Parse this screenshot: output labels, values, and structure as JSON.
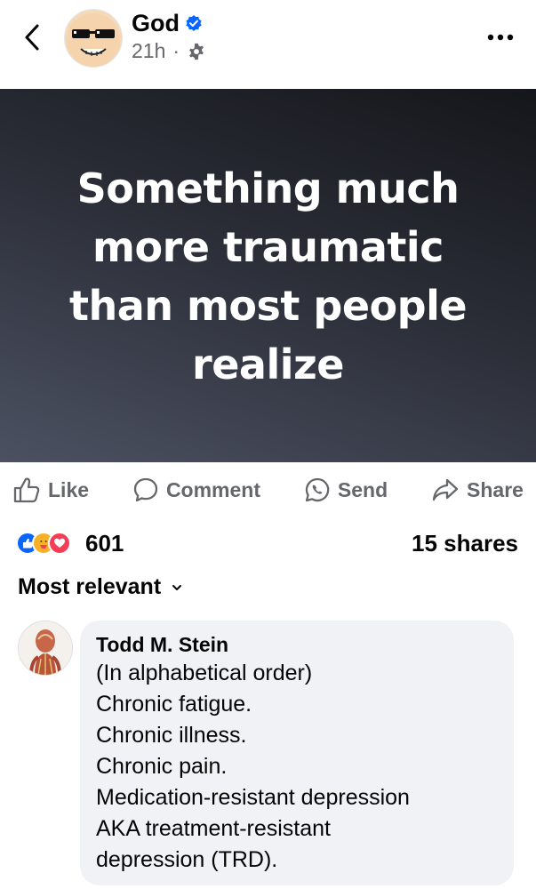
{
  "header": {
    "author_name": "God",
    "timestamp": "21h",
    "separator": "·",
    "icons": {
      "back": "chevron-left-icon",
      "verified": "verified-badge-icon",
      "privacy": "gear-icon",
      "more": "more-dots-icon"
    }
  },
  "post": {
    "text": "Something much more traumatic than most people realize",
    "background_colors": [
      "#15161b",
      "#4c5162"
    ]
  },
  "actions": {
    "like": "Like",
    "comment": "Comment",
    "send": "Send",
    "share": "Share"
  },
  "reactions": {
    "types": [
      "like",
      "care",
      "love"
    ],
    "count": "601",
    "shares": "15 shares"
  },
  "comments": {
    "sort_label": "Most relevant",
    "items": [
      {
        "author": "Todd M. Stein",
        "lines": [
          "(In alphabetical order)",
          "Chronic fatigue.",
          "Chronic illness.",
          "Chronic pain.",
          "Medication-resistant depression",
          "AKA treatment-resistant",
          "depression (TRD)."
        ]
      }
    ]
  },
  "colors": {
    "accent": "#0866ff",
    "secondary_text": "#65676b",
    "love": "#f33e58",
    "care": "#f7b125",
    "bubble": "#f0f2f5"
  }
}
